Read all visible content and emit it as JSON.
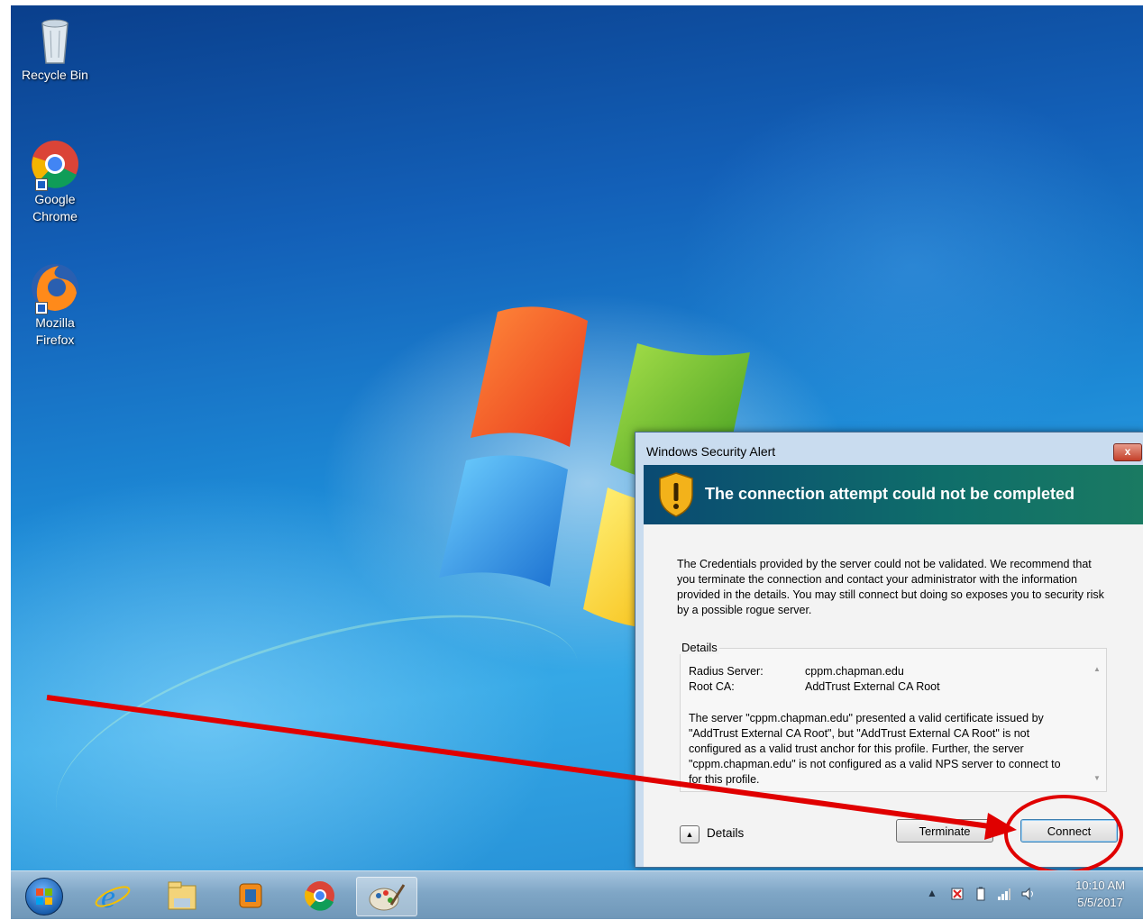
{
  "desktop": {
    "icons": [
      {
        "label_line1": "Recycle Bin",
        "label_line2": ""
      },
      {
        "label_line1": "Google",
        "label_line2": "Chrome"
      },
      {
        "label_line1": "Mozilla",
        "label_line2": "Firefox"
      }
    ]
  },
  "dialog": {
    "window_title": "Windows Security Alert",
    "close_label": "x",
    "heading": "The connection attempt could not be completed",
    "message": "The Credentials provided by the server could not be validated. We recommend that you terminate the connection and contact your administrator with the information provided in the details. You may still connect but doing so exposes you to security risk by a possible rogue server.",
    "details_legend": "Details",
    "radius_server_label": "Radius Server:",
    "radius_server_value": "cppm.chapman.edu",
    "root_ca_label": "Root CA:",
    "root_ca_value": "AddTrust External CA Root",
    "details_text": "The server \"cppm.chapman.edu\" presented a valid certificate issued by \"AddTrust External CA Root\", but \"AddTrust External CA Root\" is not configured as a valid trust anchor for this profile. Further, the server \"cppm.chapman.edu\" is not configured as a valid NPS server to connect to for this profile.",
    "details_toggle_label": "Details",
    "terminate_label": "Terminate",
    "connect_label": "Connect"
  },
  "taskbar": {
    "pinned": [
      "internet-explorer-icon",
      "file-explorer-icon",
      "media-player-icon",
      "chrome-icon",
      "paint-icon"
    ],
    "clock_time": "10:10 AM",
    "clock_date": "5/5/2017"
  },
  "annotation": {
    "color": "#e00000"
  }
}
